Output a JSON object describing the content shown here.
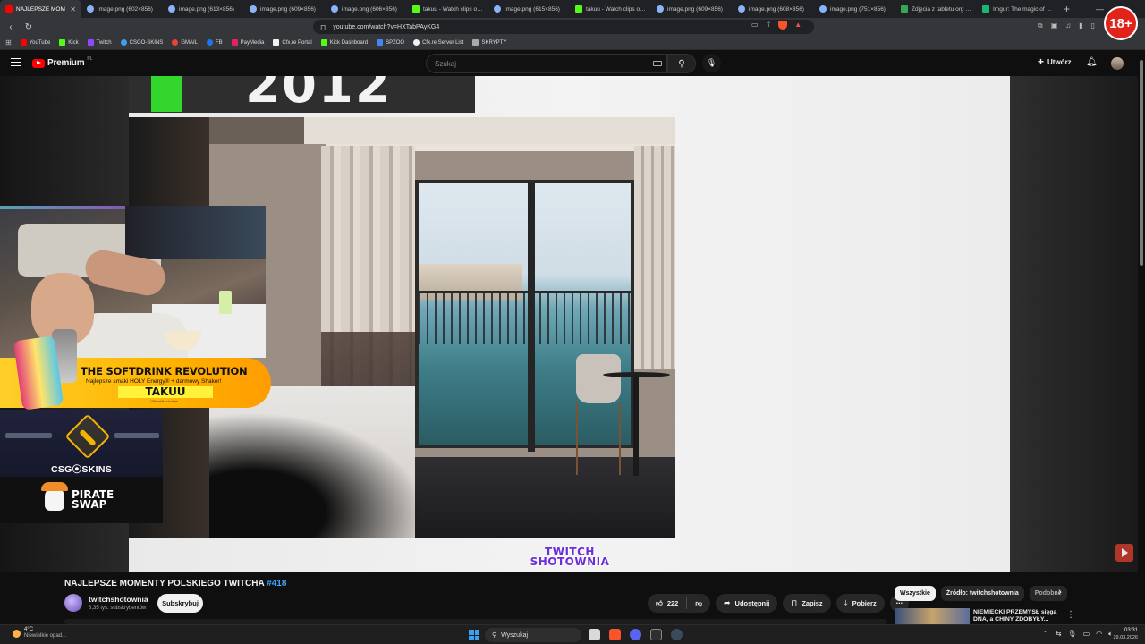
{
  "browser": {
    "tabs": [
      {
        "label": "NAJLEPSZE MOM",
        "icon": "youtube-icon",
        "active": true
      },
      {
        "label": "image.png (602×856)",
        "icon": "image-icon"
      },
      {
        "label": "image.png (613×856)",
        "icon": "image-icon"
      },
      {
        "label": "image.png (609×856)",
        "icon": "image-icon"
      },
      {
        "label": "image.png (606×856)",
        "icon": "image-icon"
      },
      {
        "label": "takuu - Watch clips on K",
        "icon": "kick-icon"
      },
      {
        "label": "image.png (615×856)",
        "icon": "image-icon"
      },
      {
        "label": "takuu - Watch clips on K",
        "icon": "kick-icon"
      },
      {
        "label": "image.png (609×856)",
        "icon": "image-icon"
      },
      {
        "label": "image.png (608×856)",
        "icon": "image-icon"
      },
      {
        "label": "image.png (751×856)",
        "icon": "image-icon"
      },
      {
        "label": "Zdjęcia z tabletu org CS",
        "icon": "sheets-icon"
      },
      {
        "label": "Imgur: The magic of the",
        "icon": "imgur-icon"
      }
    ],
    "url": "youtube.com/watch?v=HXTabPAyKG4",
    "age_badge": "18+",
    "bookmarks": [
      {
        "label": "YouTube",
        "color": "#ff0000"
      },
      {
        "label": "Kick",
        "color": "#53fc18"
      },
      {
        "label": "Twitch",
        "color": "#9146ff"
      },
      {
        "label": "CSGO-SKINS",
        "color": "#3aa0f3"
      },
      {
        "label": "GMAIL",
        "color": "#ea4335"
      },
      {
        "label": "FB",
        "color": "#1877f2"
      },
      {
        "label": "PayMedia",
        "color": "#e0245e"
      },
      {
        "label": "Cfx.re Portal",
        "color": "#f1f1f1"
      },
      {
        "label": "Kick Dashboard",
        "color": "#53fc18"
      },
      {
        "label": "SPZOO",
        "color": "#4285f4"
      },
      {
        "label": "Cfx.re Server List",
        "color": "#f1f1f1"
      },
      {
        "label": "SKRYPTY",
        "color": "#aaaaaa"
      }
    ]
  },
  "youtube": {
    "logo_text": "Premium",
    "country": "PL",
    "search_placeholder": "Szukaj",
    "create_label": "Utwórz"
  },
  "video": {
    "year_text": "2012",
    "watermark_line1": "TWITCH",
    "watermark_line2": "SHOTOWNIA",
    "title": "NAJLEPSZE MOMENTY POLSKIEGO TWITCHA",
    "title_tag": "#418",
    "channel": "twitchshotownia",
    "subscribers": "8,35 tys. subskrybentów",
    "subscribe_label": "Subskrybuj",
    "likes": "222",
    "share_label": "Udostępnij",
    "save_label": "Zapisz",
    "download_label": "Pobierz"
  },
  "overlay": {
    "promo_title": "THE SOFTDRINK REVOLUTION",
    "promo_sub": "Najlepsze smaki HOLY Energy® + darmowy Shaker!",
    "promo_code": "TAKUU",
    "promo_fine": "10% zniżki z kodem",
    "skins_logo": "CSG⦿SKINS",
    "pirate_line1": "PIRATE",
    "pirate_line2": "SWAP"
  },
  "sidebar": {
    "chips": [
      "Wszystkie",
      "Źródło: twitchshotownia",
      "Podobne"
    ],
    "rec_title": "NIEMIECKI PRZEMYSŁ sięga DNA, a CHINY ZDOBYŁY..."
  },
  "taskbar": {
    "weather_temp": "4°C",
    "weather_desc": "Niewielkie opad...",
    "search_label": "Wyszukaj",
    "time": "03:31",
    "date": "29.03.2026"
  }
}
